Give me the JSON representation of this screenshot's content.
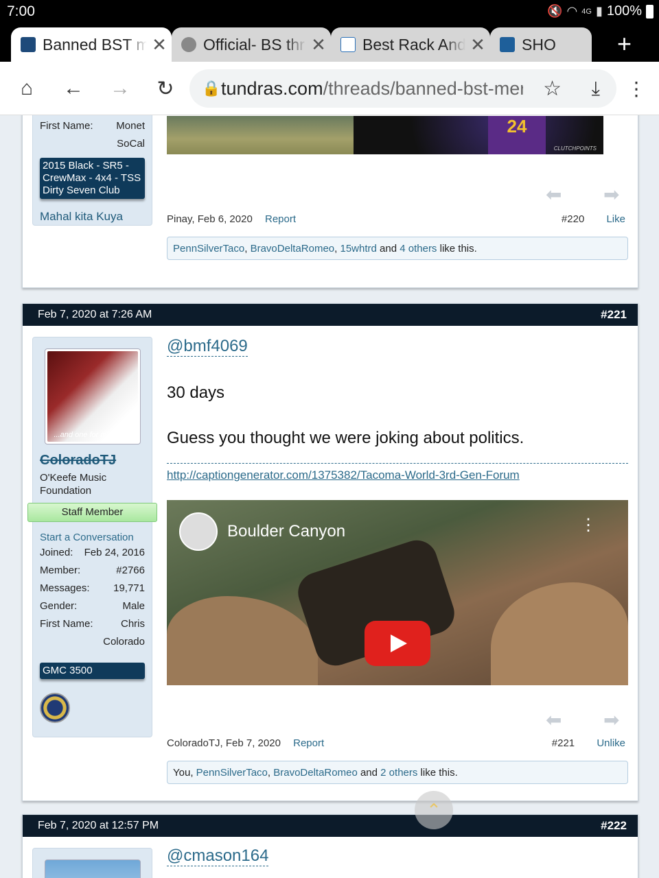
{
  "status_bar": {
    "time": "7:00",
    "signal": "4G",
    "battery": "100%"
  },
  "tabs": [
    {
      "title": "Banned BST m",
      "favicon_color": "#1e4a7a",
      "active": true
    },
    {
      "title": "Official- BS thr",
      "favicon_color": "#888888",
      "active": false
    },
    {
      "title": "Best Rack And",
      "favicon_color": "#2a70b8",
      "active": false
    },
    {
      "title": "SHO",
      "favicon_color": "#1e5f9a",
      "active": false
    }
  ],
  "toolbar": {
    "home_icon": "home-icon",
    "back_icon": "arrow-left-icon",
    "forward_icon": "arrow-right-icon",
    "reload_icon": "reload-icon",
    "url_domain": "tundras.com",
    "url_path": "/threads/banned-bst-mer",
    "bookmark_icon": "star-icon",
    "download_icon": "download-icon",
    "menu_icon": "kebab-menu-icon"
  },
  "post_220": {
    "sidebar": {
      "first_name_label": "First Name:",
      "first_name_value": "Monet",
      "location": "SoCal",
      "badge": "2015 Black - SR5 - CrewMax - 4x4 - TSS Dirty Seven Club",
      "signature_text": "Mahal kita Kuya"
    },
    "author_date": "Pinay, Feb 6, 2020",
    "report": "Report",
    "number": "#220",
    "like": "Like",
    "likes": {
      "users": [
        "PennSilverTaco",
        "BravoDeltaRomeo",
        "15whtrd"
      ],
      "and": "and",
      "others": "4 others",
      "tail": "like this."
    },
    "image_jersey_text": "24",
    "image_watermark": "CLUTCHPOINTS"
  },
  "post_221": {
    "date": "Feb 7, 2020 at 7:26 AM",
    "number": "#221",
    "username": "ColoradoTJ",
    "user_title": "O'Keefe Music Foundation",
    "staff_banner": "Staff Member",
    "avatar_caption": "...and one for my homies",
    "start_conversation": "Start a Conversation",
    "stats": [
      {
        "label": "Joined:",
        "value": "Feb 24, 2016"
      },
      {
        "label": "Member:",
        "value": "#2766"
      },
      {
        "label": "Messages:",
        "value": "19,771"
      },
      {
        "label": "Gender:",
        "value": "Male"
      },
      {
        "label": "First Name:",
        "value": "Chris"
      },
      {
        "label": "",
        "value": "Colorado"
      }
    ],
    "badge": "GMC 3500",
    "mention": "@bmf4069",
    "line1": "30 days",
    "line2": "Guess you thought we were joking about politics.",
    "sig_link": "http://captiongenerator.com/1375382/Tacoma-World-3rd-Gen-Forum",
    "video_title": "Boulder Canyon",
    "author_date": "ColoradoTJ, Feb 7, 2020",
    "report": "Report",
    "footer_number": "#221",
    "unlike": "Unlike",
    "likes": {
      "lead": "You,",
      "users": [
        "PennSilverTaco",
        "BravoDeltaRomeo"
      ],
      "and": "and",
      "others": "2 others",
      "tail": "like this."
    }
  },
  "post_222": {
    "date": "Feb 7, 2020 at 12:57 PM",
    "number": "#222",
    "mention": "@cmason164"
  }
}
